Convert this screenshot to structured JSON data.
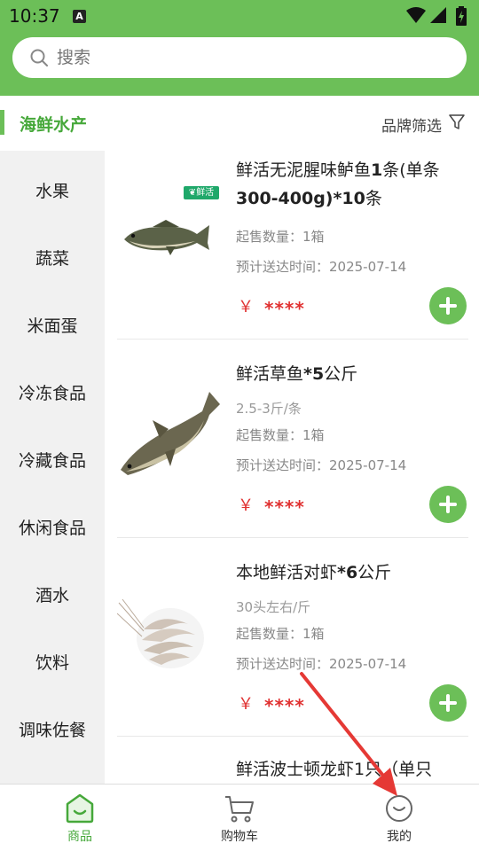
{
  "status_bar": {
    "time": "10:37",
    "notification_glyph": "A",
    "icons": [
      "wifi-icon",
      "signal-icon",
      "battery-icon"
    ]
  },
  "search": {
    "placeholder": "搜索"
  },
  "category": {
    "current": "海鲜水产",
    "brand_filter_label": "品牌筛选"
  },
  "sidebar": {
    "items": [
      {
        "label": "水果"
      },
      {
        "label": "蔬菜"
      },
      {
        "label": "米面蛋"
      },
      {
        "label": "冷冻食品"
      },
      {
        "label": "冷藏食品"
      },
      {
        "label": "休闲食品"
      },
      {
        "label": "酒水"
      },
      {
        "label": "饮料"
      },
      {
        "label": "调味佐餐"
      }
    ]
  },
  "products": [
    {
      "name_parts": [
        "鲜活无泥腥味鲈鱼",
        "1",
        "条(单条",
        "300-400g)*10",
        "条"
      ],
      "name": "鲜活无泥腥味鲈鱼1条(单条300-400g)*10条",
      "tag": "鲜活",
      "spec": "",
      "min_qty": "起售数量：1箱",
      "delivery": "预计送达时间：2025-07-14",
      "currency": "￥",
      "price": "****",
      "image": "bass-fish-image"
    },
    {
      "name": "鲜活草鱼*5公斤",
      "name_parts": [
        "鲜活草鱼",
        "*5",
        "公斤"
      ],
      "spec": "2.5-3斤/条",
      "min_qty": "起售数量：1箱",
      "delivery": "预计送达时间：2025-07-14",
      "currency": "￥",
      "price": "****",
      "image": "grass-carp-image"
    },
    {
      "name": "本地鲜活对虾*6公斤",
      "name_parts": [
        "本地鲜活对虾",
        "*6",
        "公斤"
      ],
      "spec": "30头左右/斤",
      "min_qty": "起售数量：1箱",
      "delivery": "预计送达时间：2025-07-14",
      "currency": "￥",
      "price": "****",
      "image": "prawn-image"
    },
    {
      "name": "鲜活波士顿龙虾1只（单只",
      "image": "lobster-image"
    }
  ],
  "bottom_nav": [
    {
      "label": "商品",
      "icon": "shop-icon",
      "active": true
    },
    {
      "label": "购物车",
      "icon": "cart-icon",
      "active": false
    },
    {
      "label": "我的",
      "icon": "profile-icon",
      "active": false
    }
  ],
  "colors": {
    "brand_green": "#6cbf58",
    "active_text": "#46a83a",
    "price_red": "#e03131",
    "annotation_arrow": "#e53935"
  }
}
